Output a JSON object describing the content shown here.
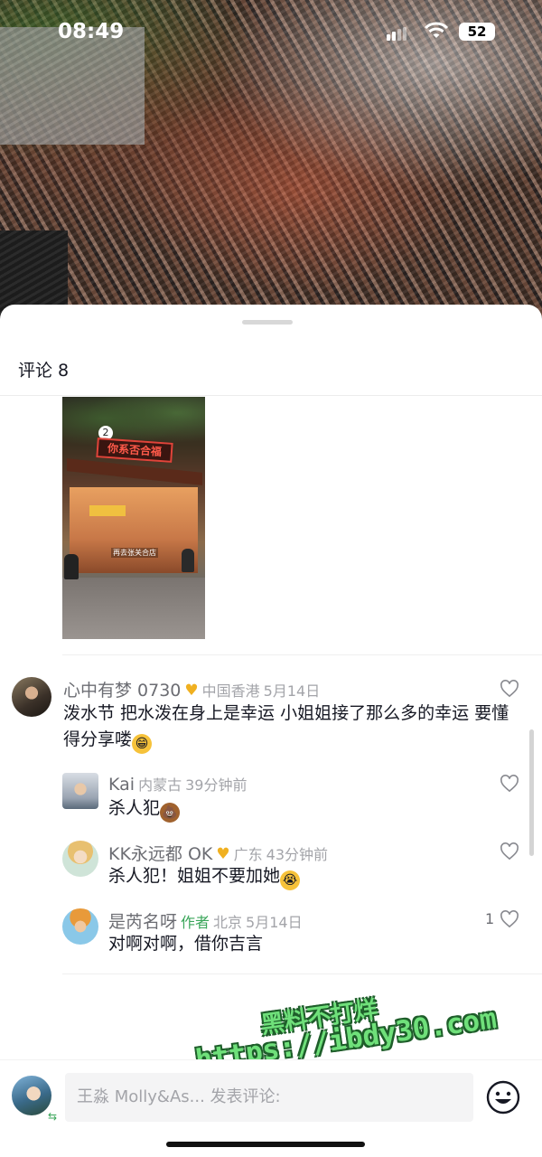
{
  "status_bar": {
    "time": "08:49",
    "battery": "52"
  },
  "comments_header": {
    "title": "评论 8"
  },
  "media": {
    "sign_text": "你系否合福",
    "sign_number": "2",
    "caption": "再去张关合店"
  },
  "comments": [
    {
      "name": "心中有梦 0730",
      "badge": "♥",
      "location": "中国香港",
      "time": "5月14日",
      "text": "泼水节  把水泼在身上是幸运 小姐姐接了那么多的幸运  要懂得分享喽",
      "emoji": "😁",
      "replies": [
        {
          "name": "Kai",
          "location": "内蒙古",
          "time": "39分钟前",
          "text": "杀人犯",
          "emoji": "💩"
        },
        {
          "name": "KK永远都 OK",
          "badge": "♥",
          "location": "广东",
          "time": "43分钟前",
          "text": "杀人犯！姐姐不要加她",
          "emoji": "😭"
        },
        {
          "name": "是芮名呀",
          "author_tag": "作者",
          "location": "北京",
          "time": "5月14日",
          "text": "对啊对啊，借你吉言",
          "likes": "1"
        }
      ]
    }
  ],
  "watermark": {
    "line1": "黑料不打烊",
    "line2": "https://ibdy30.com"
  },
  "composer": {
    "placeholder": "王淼 Molly&As... 发表评论:"
  },
  "colors": {
    "author": "#3aa65a",
    "badge": "#f0b020",
    "watermark": "#6fe07a"
  },
  "icons": [
    "signal-icon",
    "wifi-icon",
    "battery-icon",
    "heart-icon",
    "emoji-icon",
    "badge-icon"
  ]
}
